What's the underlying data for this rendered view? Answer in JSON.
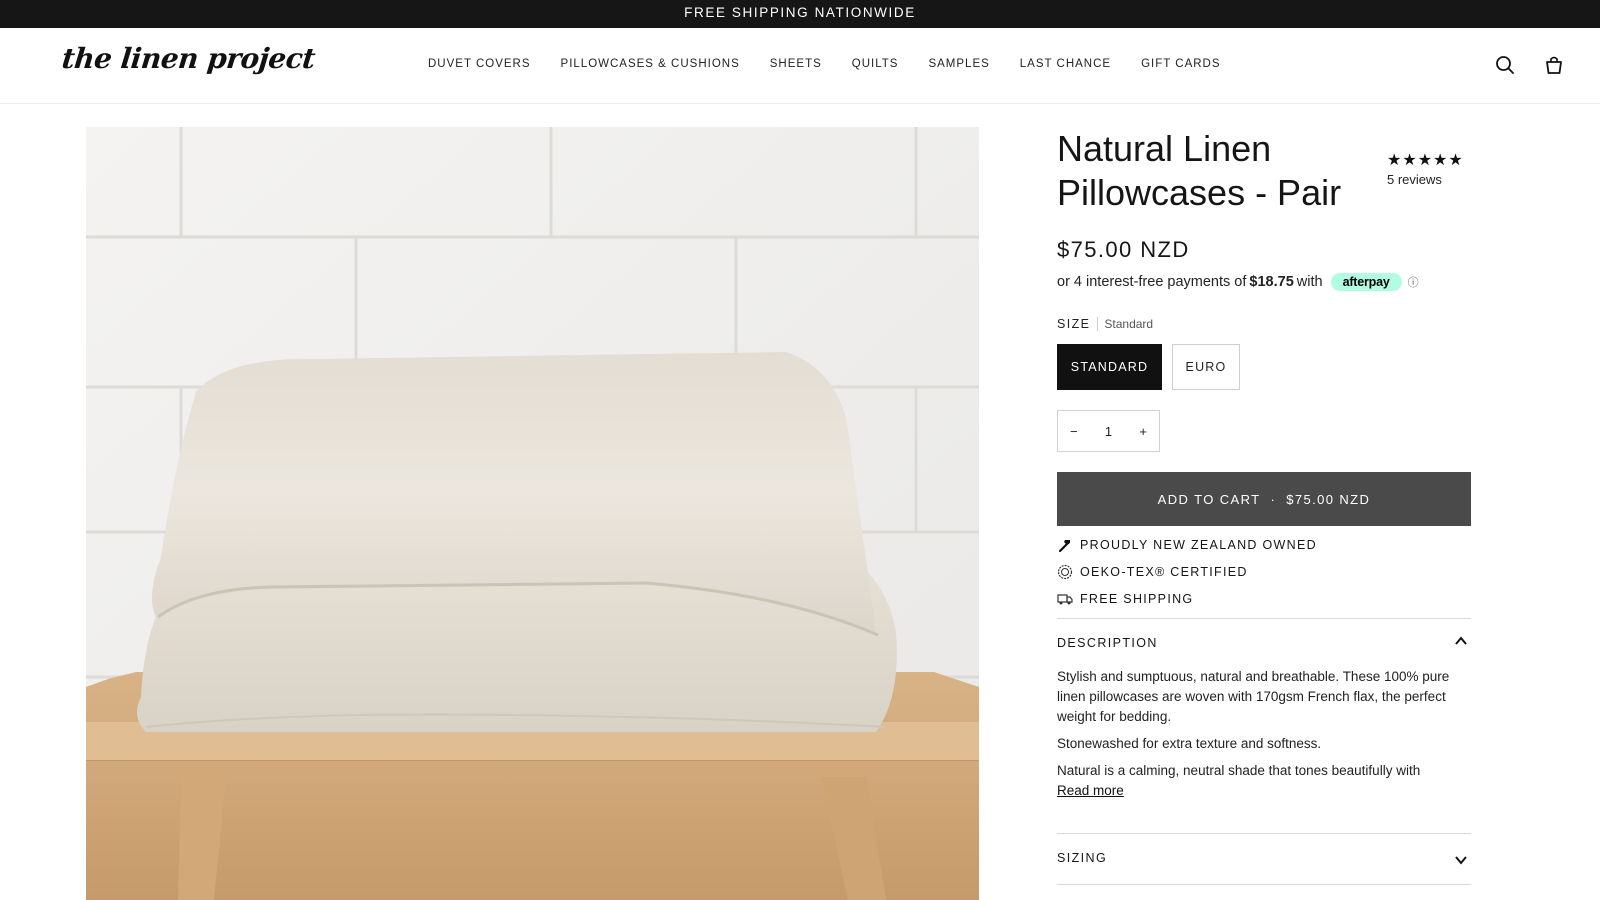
{
  "announcement": "FREE SHIPPING NATIONWIDE",
  "brand": {
    "logo_text": "the linen project"
  },
  "nav": [
    "DUVET COVERS",
    "PILLOWCASES & CUSHIONS",
    "SHEETS",
    "QUILTS",
    "SAMPLES",
    "LAST CHANCE",
    "GIFT CARDS"
  ],
  "header_icons": [
    "search-icon",
    "cart-icon"
  ],
  "product": {
    "title": "Natural Linen Pillowcases - Pair",
    "rating": {
      "stars": "★★★★★",
      "reviews": "5 reviews"
    },
    "price": "$75.00 NZD",
    "afterpay": {
      "prefix": "or 4 interest-free payments of",
      "amount": "$18.75",
      "suffix": "with",
      "brand": "afterpay",
      "info": "ⓘ"
    },
    "size": {
      "label": "SIZE",
      "selected": "Standard",
      "options": [
        "STANDARD",
        "EURO"
      ]
    },
    "quantity": {
      "minus": "−",
      "value": "1",
      "plus": "+"
    },
    "add_to_cart": {
      "label": "ADD TO CART",
      "separator": "·",
      "price": "$75.00 NZD"
    },
    "features": [
      "PROUDLY NEW ZEALAND OWNED",
      "OEKO-TEX® CERTIFIED",
      "FREE SHIPPING"
    ],
    "description": {
      "title": "DESCRIPTION",
      "paragraphs": [
        "Stylish and sumptuous, natural and breathable. These 100% pure linen pillowcases are woven with 170gsm French flax, the perfect weight for bedding.",
        "Stonewashed for extra texture and softness.",
        "Natural is a calming, neutral shade that tones beautifully with"
      ],
      "read_more": "Read more"
    },
    "sizing": {
      "title": "SIZING"
    }
  },
  "colors": {
    "announcement_bg": "#161616",
    "button_dark": "#4a4a4a",
    "afterpay_mint": "#b2fce4"
  }
}
